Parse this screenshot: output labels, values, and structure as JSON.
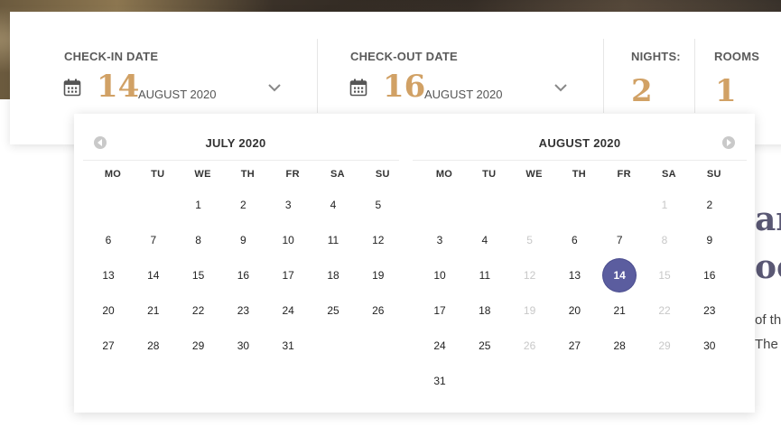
{
  "booking": {
    "checkin": {
      "label": "CHECK-IN DATE",
      "day": "14",
      "month_year": "AUGUST 2020"
    },
    "checkout": {
      "label": "CHECK-OUT DATE",
      "day": "16",
      "month_year": "AUGUST 2020"
    },
    "nights": {
      "label": "NIGHTS:",
      "value": "2"
    },
    "rooms": {
      "label": "ROOMS",
      "value": "1"
    }
  },
  "calendar": {
    "weekdays": [
      "MO",
      "TU",
      "WE",
      "TH",
      "FR",
      "SA",
      "SU"
    ],
    "months": [
      {
        "title": "JULY 2020",
        "first_weekday": 2,
        "days": 31,
        "disabled": [],
        "selected": null
      },
      {
        "title": "AUGUST 2020",
        "first_weekday": 5,
        "days": 31,
        "disabled": [
          1,
          5,
          8,
          12,
          15,
          19,
          22,
          26,
          29
        ],
        "selected": 14
      }
    ]
  },
  "background_text": {
    "heading_line1": "ar",
    "heading_line2": "oo",
    "para_line1": "of th",
    "para_line2": "The"
  },
  "colors": {
    "accent_gold": "#d1a165",
    "selected_day": "#5b5d9f",
    "disabled_day": "#c8c8c8"
  }
}
